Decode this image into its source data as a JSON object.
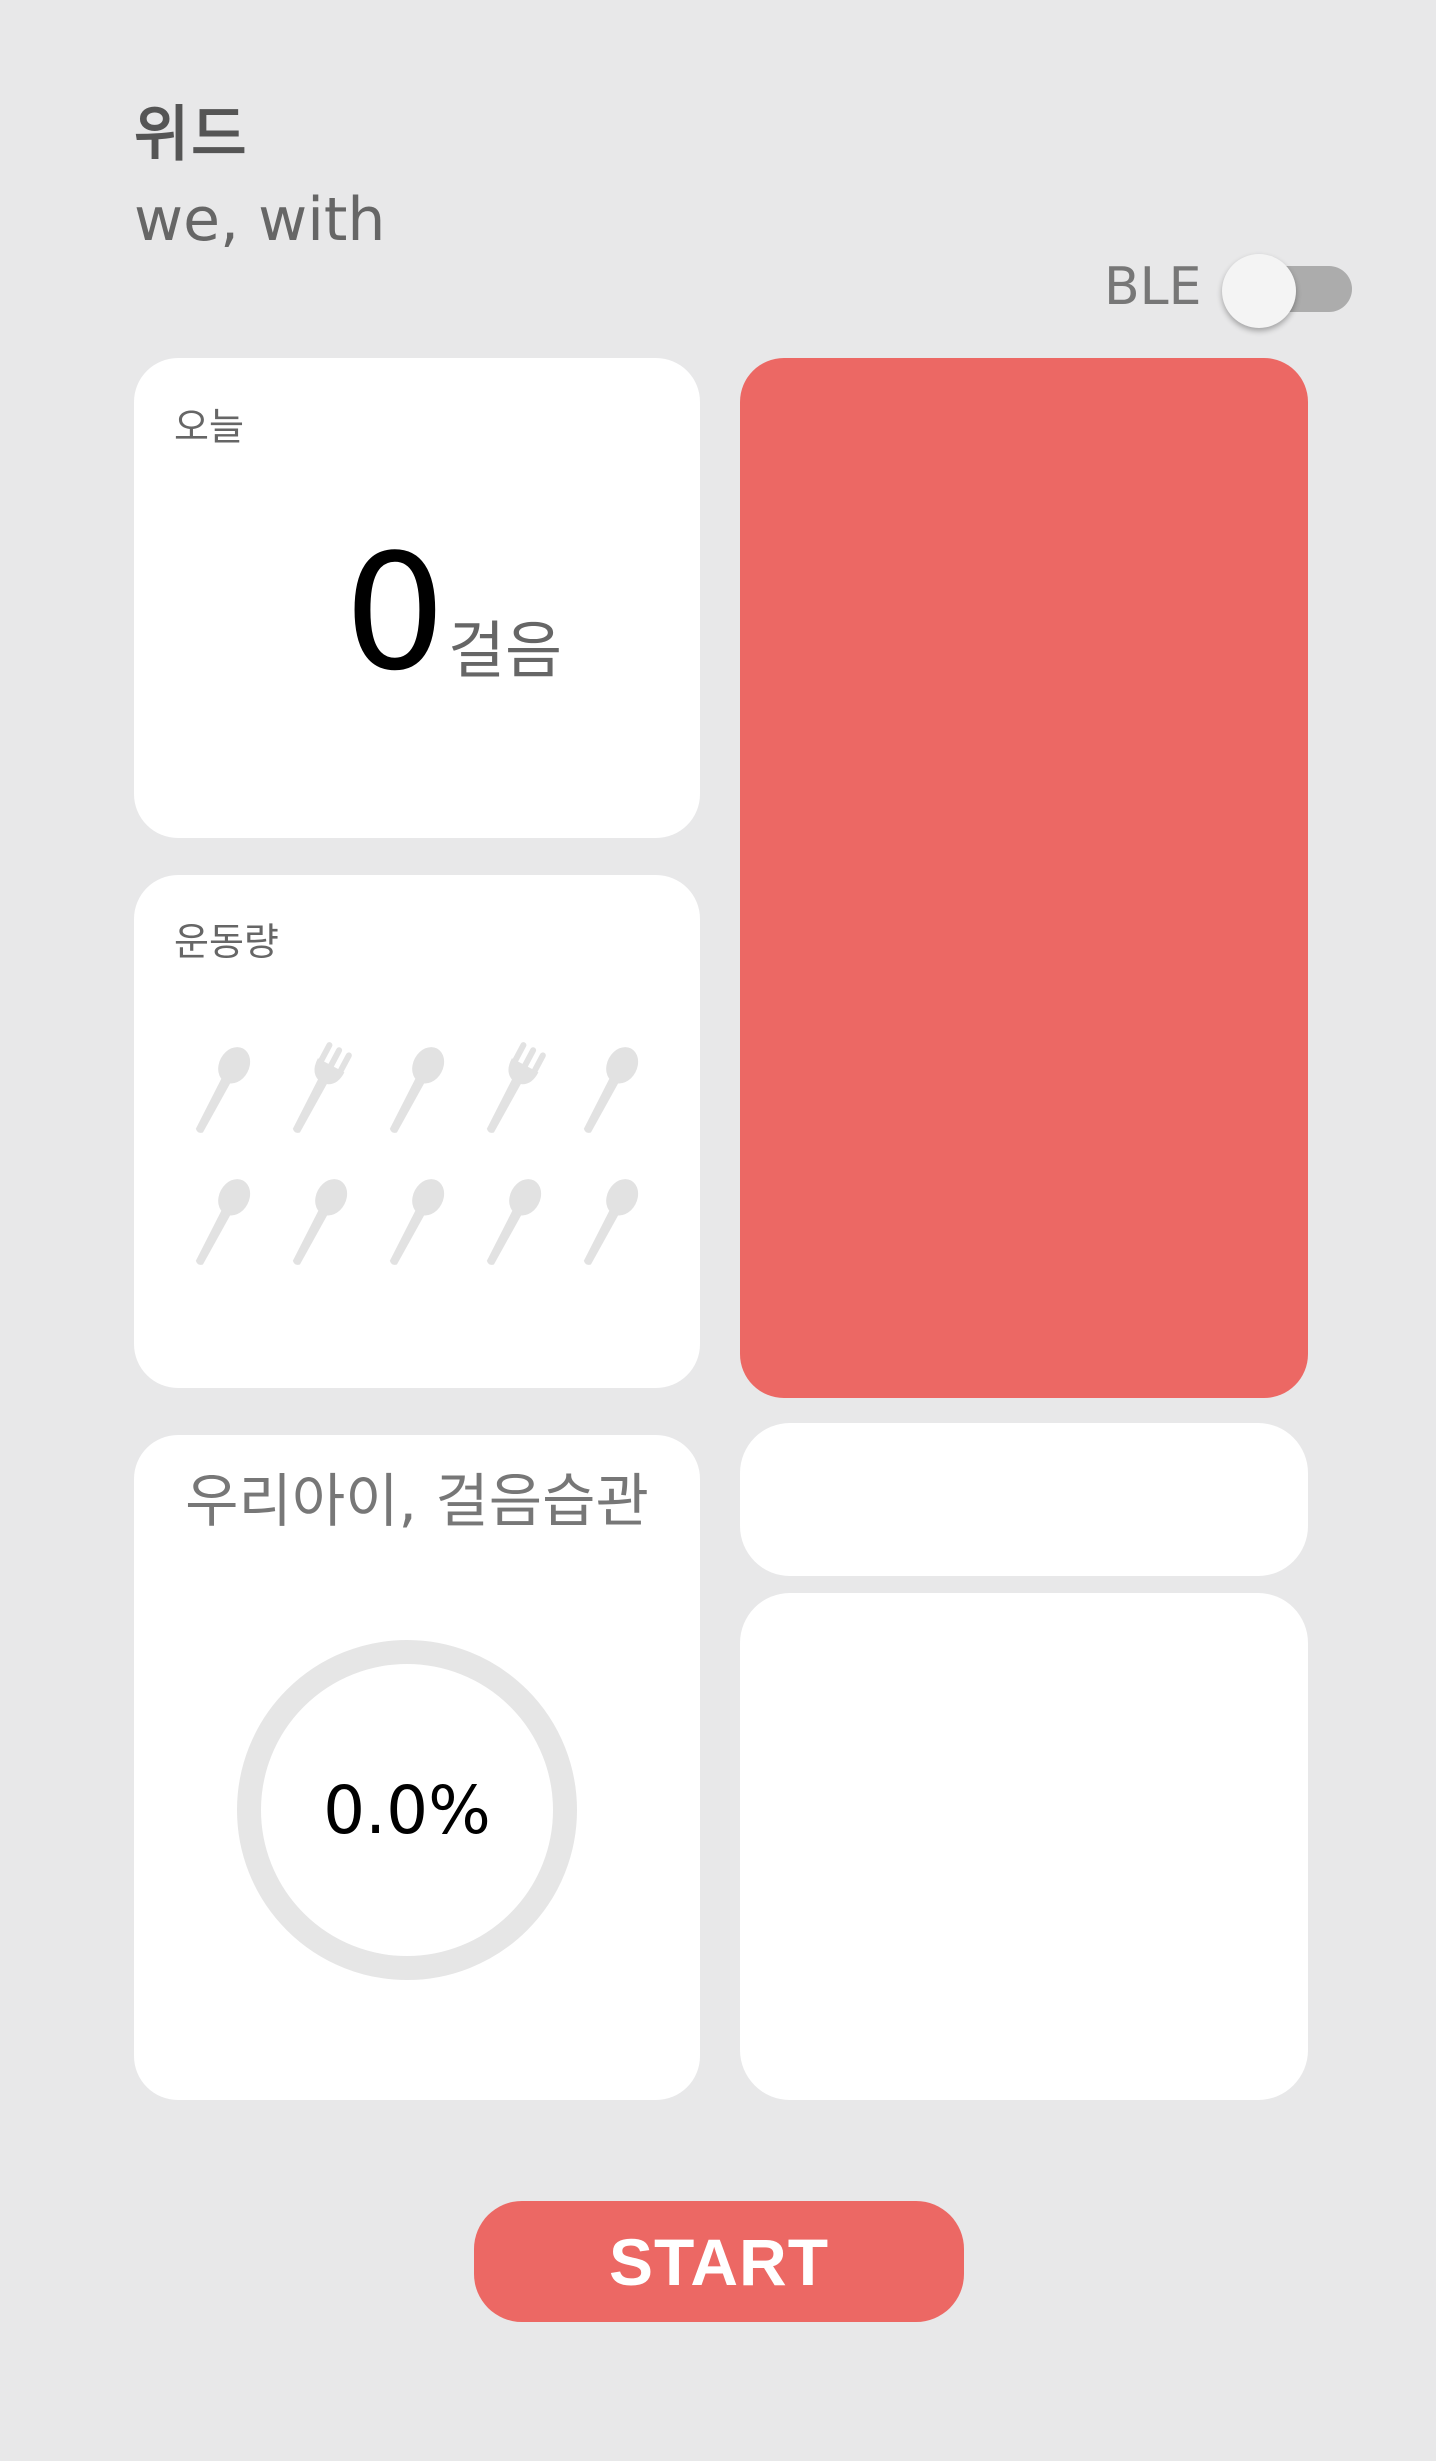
{
  "header": {
    "title": "위드",
    "subtitle": "we, with"
  },
  "ble": {
    "label": "BLE",
    "enabled": false
  },
  "today_card": {
    "label": "오늘",
    "steps": "0",
    "unit": "걸음"
  },
  "exercise_card": {
    "label": "운동량",
    "icons": [
      "spoon-icon",
      "fork-icon",
      "spoon-icon",
      "fork-icon",
      "spoon-icon",
      "spoon-icon",
      "spoon-icon",
      "spoon-icon",
      "spoon-icon",
      "spoon-icon"
    ]
  },
  "habit_card": {
    "title": "우리아이, 걸음습관",
    "progress_text": "0.0%",
    "progress": 0.0
  },
  "start_button": {
    "label": "START"
  },
  "colors": {
    "accent": "#ec6864",
    "background": "#e8e8e9",
    "card": "#ffffff",
    "icon": "#e2e2e2",
    "ring": "#e6e6e6"
  }
}
